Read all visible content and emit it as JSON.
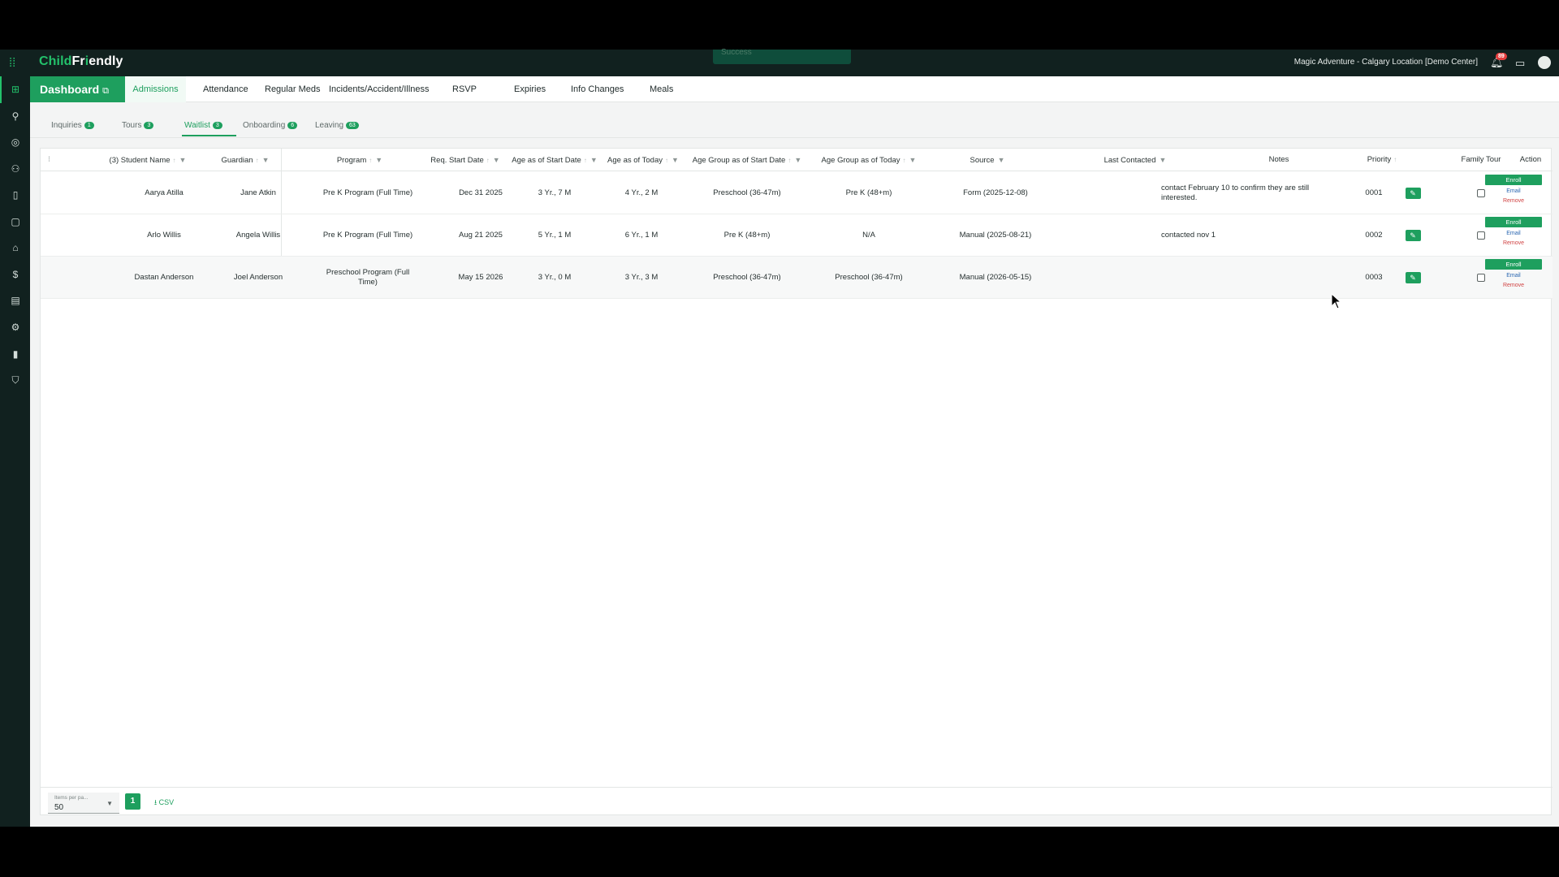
{
  "topbar": {
    "brand_part1": "Chi",
    "brand_part2": "ld",
    "brand_part3": "Fr",
    "brand_part4": "i",
    "brand_part5": "endly",
    "toast": "Success",
    "location": "Magic Adventure - Calgary Location [Demo Center]",
    "notification_count": "89"
  },
  "nav": {
    "dashboard": "Dashboard",
    "tabs": [
      "Admissions",
      "Attendance",
      "Regular Meds",
      "Incidents/Accident/Illness",
      "RSVP",
      "Expiries",
      "Info Changes",
      "Meals"
    ]
  },
  "subtabs": [
    {
      "label": "Inquiries",
      "count": "1"
    },
    {
      "label": "Tours",
      "count": "3"
    },
    {
      "label": "Waitlist",
      "count": "3"
    },
    {
      "label": "Onboarding",
      "count": "6"
    },
    {
      "label": "Leaving",
      "count": "63"
    }
  ],
  "table": {
    "headers": {
      "student": "(3) Student Name",
      "guardian": "Guardian",
      "program": "Program",
      "req_start": "Req. Start Date",
      "age_start": "Age as of Start Date",
      "age_today": "Age as of Today",
      "group_start": "Age Group as of Start Date",
      "group_today": "Age Group as of Today",
      "source": "Source",
      "last_contacted": "Last Contacted",
      "notes": "Notes",
      "priority": "Priority",
      "family_tour": "Family Tour",
      "action": "Action"
    },
    "rows": [
      {
        "student": "Aarya Atilla",
        "guardian": "Jane Atkin",
        "program": "Pre K Program (Full Time)",
        "req_start": "Dec 31 2025",
        "age_start": "3 Yr., 7 M",
        "age_today": "4 Yr., 2 M",
        "group_start": "Preschool (36-47m)",
        "group_today": "Pre K (48+m)",
        "source": "Form (2025-12-08)",
        "last_contacted": "",
        "notes": "contact February 10 to confirm they are still interested.",
        "priority": "0001"
      },
      {
        "student": "Arlo Willis",
        "guardian": "Angela Willis",
        "program": "Pre K Program (Full Time)",
        "req_start": "Aug 21 2025",
        "age_start": "5 Yr., 1 M",
        "age_today": "6 Yr., 1 M",
        "group_start": "Pre K (48+m)",
        "group_today": "N/A",
        "source": "Manual (2025-08-21)",
        "last_contacted": "",
        "notes": "contacted nov 1",
        "priority": "0002"
      },
      {
        "student": "Dastan Anderson",
        "guardian": "Joel Anderson",
        "program": "Preschool Program (Full Time)",
        "req_start": "May 15 2026",
        "age_start": "3 Yr., 0 M",
        "age_today": "3 Yr., 3 M",
        "group_start": "Preschool (36-47m)",
        "group_today": "Preschool (36-47m)",
        "source": "Manual (2026-05-15)",
        "last_contacted": "",
        "notes": "",
        "priority": "0003"
      }
    ],
    "actions": {
      "enroll": "Enroll",
      "email": "Email",
      "remove": "Remove"
    }
  },
  "footer": {
    "per_page_label": "Items per pa...",
    "per_page_value": "50",
    "page": "1",
    "csv": "CSV"
  },
  "colors": {
    "accent": "#1e9f5e",
    "sidebar": "#11211f",
    "remove": "#d04343",
    "email": "#2a66b1"
  }
}
